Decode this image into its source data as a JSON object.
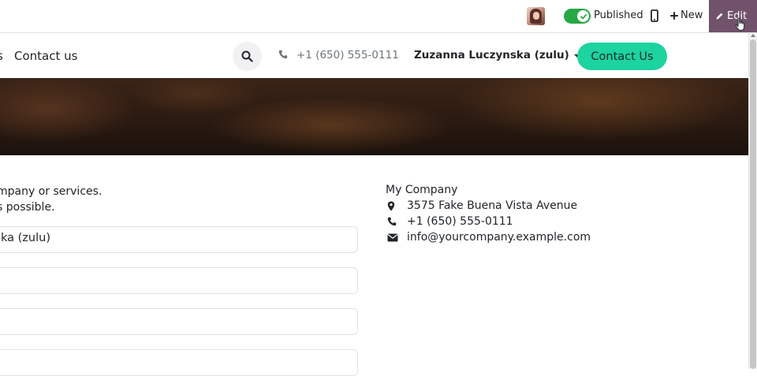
{
  "adminbar": {
    "published_label": "Published",
    "new_label": "New",
    "edit_label": "Edit",
    "accent_color": "#71526b",
    "toggle_color": "#28a745"
  },
  "header": {
    "nav_truncated": "s",
    "nav_contact": "Contact us",
    "phone": "+1 (650) 555-0111",
    "user": "Zuzanna Luczynska (zulu)",
    "cta": "Contact Us",
    "cta_color": "#1dd3a0"
  },
  "form": {
    "intro_line1": "mpany or services.",
    "intro_line2": "s possible.",
    "name_value": "ka (zulu)",
    "field2_value": "",
    "field3_value": "",
    "field4_value": ""
  },
  "info": {
    "company": "My Company",
    "address": "3575 Fake Buena Vista Avenue",
    "phone": "+1 (650) 555-0111",
    "email": "info@yourcompany.example.com"
  },
  "icons": [
    "user-avatar",
    "check-icon",
    "mobile-icon",
    "plus-icon",
    "pencil-icon",
    "cursor-icon",
    "search-icon",
    "phone-icon",
    "map-marker-icon",
    "envelope-icon"
  ]
}
